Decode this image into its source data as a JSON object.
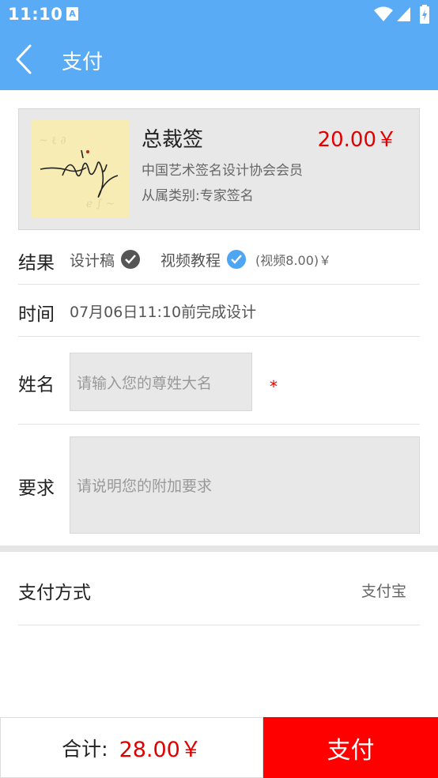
{
  "status_bar": {
    "time": "11:10",
    "app_badge": "A"
  },
  "app_bar": {
    "title": "支付"
  },
  "product": {
    "name": "总裁签",
    "price": "20.00￥",
    "description": "中国艺术签名设计协会会员",
    "category": "从属类别:专家签名"
  },
  "result": {
    "label": "结果",
    "option_draft": "设计稿",
    "option_video": "视频教程",
    "video_price": "(视频8.00)￥"
  },
  "time_row": {
    "label": "时间",
    "value": "07月06日11:10前完成设计"
  },
  "name_row": {
    "label": "姓名",
    "placeholder": "请输入您的尊姓大名",
    "required_mark": "*"
  },
  "request_row": {
    "label": "要求",
    "placeholder": "请说明您的附加要求"
  },
  "payment": {
    "label": "支付方式",
    "value": "支付宝"
  },
  "footer": {
    "total_label": "合计:",
    "total_value": "28.00￥",
    "pay_button": "支付"
  },
  "colors": {
    "accent": "#5aabf5",
    "price": "#e00000",
    "pay_button": "#ff0000"
  },
  "icons": [
    "back-arrow-icon",
    "wifi-icon",
    "cellular-icon",
    "battery-icon",
    "check-circle-icon"
  ]
}
